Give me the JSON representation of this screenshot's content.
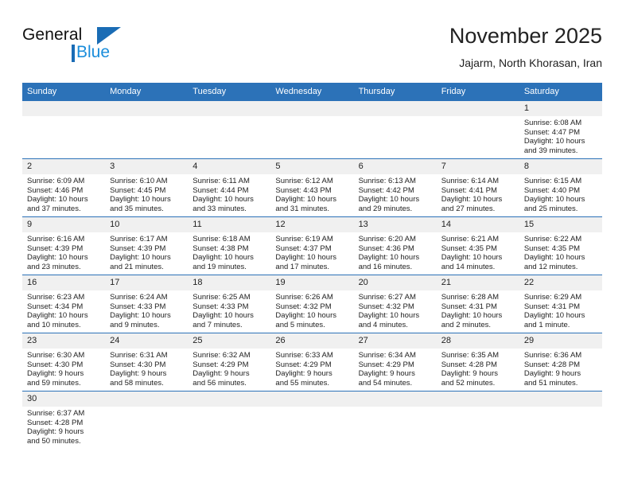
{
  "brand": {
    "name_part1": "General",
    "name_part2": "Blue",
    "accent_color": "#1a6cb5",
    "accent_light": "#1a8ddb"
  },
  "header": {
    "title": "November 2025",
    "subtitle": "Jajarm, North Khorasan, Iran"
  },
  "theme": {
    "header_blue": "#2c72b8",
    "daynum_gray": "#f0f0f0"
  },
  "weekday_headers": [
    "Sunday",
    "Monday",
    "Tuesday",
    "Wednesday",
    "Thursday",
    "Friday",
    "Saturday"
  ],
  "weeks": [
    [
      {
        "day": "",
        "sunrise": "",
        "sunset": "",
        "daylight_line1": "",
        "daylight_line2": ""
      },
      {
        "day": "",
        "sunrise": "",
        "sunset": "",
        "daylight_line1": "",
        "daylight_line2": ""
      },
      {
        "day": "",
        "sunrise": "",
        "sunset": "",
        "daylight_line1": "",
        "daylight_line2": ""
      },
      {
        "day": "",
        "sunrise": "",
        "sunset": "",
        "daylight_line1": "",
        "daylight_line2": ""
      },
      {
        "day": "",
        "sunrise": "",
        "sunset": "",
        "daylight_line1": "",
        "daylight_line2": ""
      },
      {
        "day": "",
        "sunrise": "",
        "sunset": "",
        "daylight_line1": "",
        "daylight_line2": ""
      },
      {
        "day": "1",
        "sunrise": "Sunrise: 6:08 AM",
        "sunset": "Sunset: 4:47 PM",
        "daylight_line1": "Daylight: 10 hours",
        "daylight_line2": "and 39 minutes."
      }
    ],
    [
      {
        "day": "2",
        "sunrise": "Sunrise: 6:09 AM",
        "sunset": "Sunset: 4:46 PM",
        "daylight_line1": "Daylight: 10 hours",
        "daylight_line2": "and 37 minutes."
      },
      {
        "day": "3",
        "sunrise": "Sunrise: 6:10 AM",
        "sunset": "Sunset: 4:45 PM",
        "daylight_line1": "Daylight: 10 hours",
        "daylight_line2": "and 35 minutes."
      },
      {
        "day": "4",
        "sunrise": "Sunrise: 6:11 AM",
        "sunset": "Sunset: 4:44 PM",
        "daylight_line1": "Daylight: 10 hours",
        "daylight_line2": "and 33 minutes."
      },
      {
        "day": "5",
        "sunrise": "Sunrise: 6:12 AM",
        "sunset": "Sunset: 4:43 PM",
        "daylight_line1": "Daylight: 10 hours",
        "daylight_line2": "and 31 minutes."
      },
      {
        "day": "6",
        "sunrise": "Sunrise: 6:13 AM",
        "sunset": "Sunset: 4:42 PM",
        "daylight_line1": "Daylight: 10 hours",
        "daylight_line2": "and 29 minutes."
      },
      {
        "day": "7",
        "sunrise": "Sunrise: 6:14 AM",
        "sunset": "Sunset: 4:41 PM",
        "daylight_line1": "Daylight: 10 hours",
        "daylight_line2": "and 27 minutes."
      },
      {
        "day": "8",
        "sunrise": "Sunrise: 6:15 AM",
        "sunset": "Sunset: 4:40 PM",
        "daylight_line1": "Daylight: 10 hours",
        "daylight_line2": "and 25 minutes."
      }
    ],
    [
      {
        "day": "9",
        "sunrise": "Sunrise: 6:16 AM",
        "sunset": "Sunset: 4:39 PM",
        "daylight_line1": "Daylight: 10 hours",
        "daylight_line2": "and 23 minutes."
      },
      {
        "day": "10",
        "sunrise": "Sunrise: 6:17 AM",
        "sunset": "Sunset: 4:39 PM",
        "daylight_line1": "Daylight: 10 hours",
        "daylight_line2": "and 21 minutes."
      },
      {
        "day": "11",
        "sunrise": "Sunrise: 6:18 AM",
        "sunset": "Sunset: 4:38 PM",
        "daylight_line1": "Daylight: 10 hours",
        "daylight_line2": "and 19 minutes."
      },
      {
        "day": "12",
        "sunrise": "Sunrise: 6:19 AM",
        "sunset": "Sunset: 4:37 PM",
        "daylight_line1": "Daylight: 10 hours",
        "daylight_line2": "and 17 minutes."
      },
      {
        "day": "13",
        "sunrise": "Sunrise: 6:20 AM",
        "sunset": "Sunset: 4:36 PM",
        "daylight_line1": "Daylight: 10 hours",
        "daylight_line2": "and 16 minutes."
      },
      {
        "day": "14",
        "sunrise": "Sunrise: 6:21 AM",
        "sunset": "Sunset: 4:35 PM",
        "daylight_line1": "Daylight: 10 hours",
        "daylight_line2": "and 14 minutes."
      },
      {
        "day": "15",
        "sunrise": "Sunrise: 6:22 AM",
        "sunset": "Sunset: 4:35 PM",
        "daylight_line1": "Daylight: 10 hours",
        "daylight_line2": "and 12 minutes."
      }
    ],
    [
      {
        "day": "16",
        "sunrise": "Sunrise: 6:23 AM",
        "sunset": "Sunset: 4:34 PM",
        "daylight_line1": "Daylight: 10 hours",
        "daylight_line2": "and 10 minutes."
      },
      {
        "day": "17",
        "sunrise": "Sunrise: 6:24 AM",
        "sunset": "Sunset: 4:33 PM",
        "daylight_line1": "Daylight: 10 hours",
        "daylight_line2": "and 9 minutes."
      },
      {
        "day": "18",
        "sunrise": "Sunrise: 6:25 AM",
        "sunset": "Sunset: 4:33 PM",
        "daylight_line1": "Daylight: 10 hours",
        "daylight_line2": "and 7 minutes."
      },
      {
        "day": "19",
        "sunrise": "Sunrise: 6:26 AM",
        "sunset": "Sunset: 4:32 PM",
        "daylight_line1": "Daylight: 10 hours",
        "daylight_line2": "and 5 minutes."
      },
      {
        "day": "20",
        "sunrise": "Sunrise: 6:27 AM",
        "sunset": "Sunset: 4:32 PM",
        "daylight_line1": "Daylight: 10 hours",
        "daylight_line2": "and 4 minutes."
      },
      {
        "day": "21",
        "sunrise": "Sunrise: 6:28 AM",
        "sunset": "Sunset: 4:31 PM",
        "daylight_line1": "Daylight: 10 hours",
        "daylight_line2": "and 2 minutes."
      },
      {
        "day": "22",
        "sunrise": "Sunrise: 6:29 AM",
        "sunset": "Sunset: 4:31 PM",
        "daylight_line1": "Daylight: 10 hours",
        "daylight_line2": "and 1 minute."
      }
    ],
    [
      {
        "day": "23",
        "sunrise": "Sunrise: 6:30 AM",
        "sunset": "Sunset: 4:30 PM",
        "daylight_line1": "Daylight: 9 hours",
        "daylight_line2": "and 59 minutes."
      },
      {
        "day": "24",
        "sunrise": "Sunrise: 6:31 AM",
        "sunset": "Sunset: 4:30 PM",
        "daylight_line1": "Daylight: 9 hours",
        "daylight_line2": "and 58 minutes."
      },
      {
        "day": "25",
        "sunrise": "Sunrise: 6:32 AM",
        "sunset": "Sunset: 4:29 PM",
        "daylight_line1": "Daylight: 9 hours",
        "daylight_line2": "and 56 minutes."
      },
      {
        "day": "26",
        "sunrise": "Sunrise: 6:33 AM",
        "sunset": "Sunset: 4:29 PM",
        "daylight_line1": "Daylight: 9 hours",
        "daylight_line2": "and 55 minutes."
      },
      {
        "day": "27",
        "sunrise": "Sunrise: 6:34 AM",
        "sunset": "Sunset: 4:29 PM",
        "daylight_line1": "Daylight: 9 hours",
        "daylight_line2": "and 54 minutes."
      },
      {
        "day": "28",
        "sunrise": "Sunrise: 6:35 AM",
        "sunset": "Sunset: 4:28 PM",
        "daylight_line1": "Daylight: 9 hours",
        "daylight_line2": "and 52 minutes."
      },
      {
        "day": "29",
        "sunrise": "Sunrise: 6:36 AM",
        "sunset": "Sunset: 4:28 PM",
        "daylight_line1": "Daylight: 9 hours",
        "daylight_line2": "and 51 minutes."
      }
    ],
    [
      {
        "day": "30",
        "sunrise": "Sunrise: 6:37 AM",
        "sunset": "Sunset: 4:28 PM",
        "daylight_line1": "Daylight: 9 hours",
        "daylight_line2": "and 50 minutes."
      },
      {
        "day": "",
        "sunrise": "",
        "sunset": "",
        "daylight_line1": "",
        "daylight_line2": ""
      },
      {
        "day": "",
        "sunrise": "",
        "sunset": "",
        "daylight_line1": "",
        "daylight_line2": ""
      },
      {
        "day": "",
        "sunrise": "",
        "sunset": "",
        "daylight_line1": "",
        "daylight_line2": ""
      },
      {
        "day": "",
        "sunrise": "",
        "sunset": "",
        "daylight_line1": "",
        "daylight_line2": ""
      },
      {
        "day": "",
        "sunrise": "",
        "sunset": "",
        "daylight_line1": "",
        "daylight_line2": ""
      },
      {
        "day": "",
        "sunrise": "",
        "sunset": "",
        "daylight_line1": "",
        "daylight_line2": ""
      }
    ]
  ]
}
